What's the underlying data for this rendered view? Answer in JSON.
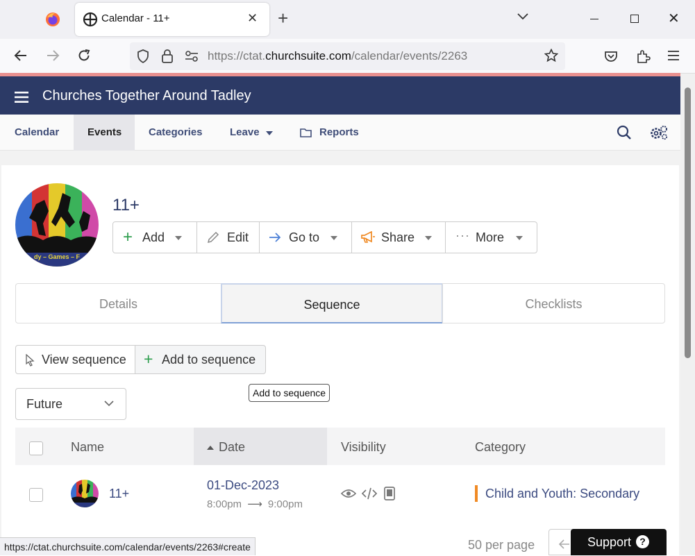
{
  "browser": {
    "tab_title": "Calendar - 11+",
    "url_prefix": "https://ctat.",
    "url_domain": "churchsuite.com",
    "url_path": "/calendar/events/2263",
    "status_url": "https://ctat.churchsuite.com/calendar/events/2263#create"
  },
  "app": {
    "org_name": "Churches Together Around Tadley",
    "nav": {
      "calendar": "Calendar",
      "events": "Events",
      "categories": "Categories",
      "leave": "Leave",
      "reports": "Reports"
    }
  },
  "event": {
    "title": "11+",
    "avatar_text": "dy – Games – F",
    "actions": {
      "add": "Add",
      "edit": "Edit",
      "goto": "Go to",
      "share": "Share",
      "more": "More"
    },
    "tabs": {
      "details": "Details",
      "sequence": "Sequence",
      "checklists": "Checklists"
    },
    "sequence": {
      "view": "View sequence",
      "add": "Add to sequence",
      "tooltip": "Add to sequence"
    },
    "filter": {
      "value": "Future"
    },
    "table": {
      "headers": {
        "name": "Name",
        "date": "Date",
        "visibility": "Visibility",
        "category": "Category"
      },
      "rows": [
        {
          "name": "11+",
          "date": "01-Dec-2023",
          "start": "8:00pm",
          "arrow": "⟶",
          "end": "9:00pm",
          "category": "Child and Youth: Secondary"
        }
      ]
    },
    "per_page": "50 per page",
    "support": "Support"
  },
  "colors": {
    "header": "#2c3a66",
    "accent_green": "#2e9e4e",
    "link": "#3b4a80",
    "category_bar": "#f08a24"
  }
}
